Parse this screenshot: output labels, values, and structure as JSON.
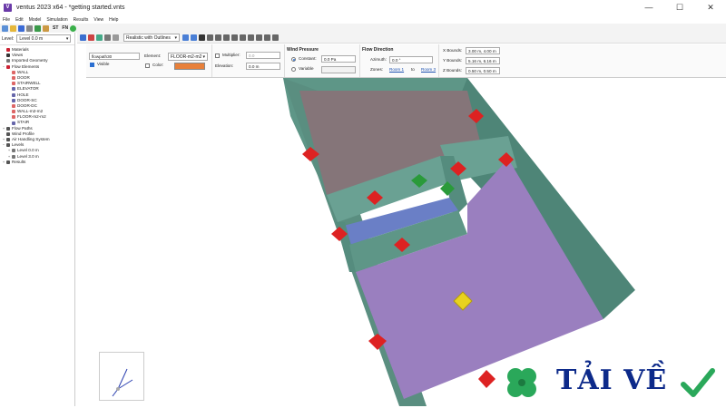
{
  "window": {
    "title": "ventus 2023 x64 - *getting started.vnts",
    "app_icon": "V"
  },
  "menu": [
    "File",
    "Edit",
    "Model",
    "Simulation",
    "Results",
    "View",
    "Help"
  ],
  "toolbar": {
    "st_label": "ST",
    "fn_label": "FN"
  },
  "level": {
    "label": "Level:",
    "value": "Level 0.0 m"
  },
  "tree": [
    {
      "label": "Materials",
      "indent": 0,
      "color": "#c23",
      "exp": ""
    },
    {
      "label": "Views",
      "indent": 0,
      "color": "#333",
      "exp": ""
    },
    {
      "label": "Imported Geometry",
      "indent": 0,
      "color": "#777",
      "exp": ""
    },
    {
      "label": "Flow Elements",
      "indent": 0,
      "color": "#c23",
      "exp": "−"
    },
    {
      "label": "WALL",
      "indent": 2,
      "color": "#d66",
      "exp": ""
    },
    {
      "label": "DOOR",
      "indent": 2,
      "color": "#d66",
      "exp": ""
    },
    {
      "label": "STAIRWELL",
      "indent": 2,
      "color": "#d66",
      "exp": ""
    },
    {
      "label": "ELEVATOR",
      "indent": 2,
      "color": "#66a",
      "exp": ""
    },
    {
      "label": "HOLE",
      "indent": 2,
      "color": "#66a",
      "exp": ""
    },
    {
      "label": "DOOR-SC",
      "indent": 2,
      "color": "#66a",
      "exp": ""
    },
    {
      "label": "DOOR-DC",
      "indent": 2,
      "color": "#d66",
      "exp": ""
    },
    {
      "label": "WALL-m2-m2",
      "indent": 2,
      "color": "#d66",
      "exp": ""
    },
    {
      "label": "FLOOR-m2-m2",
      "indent": 2,
      "color": "#d66",
      "exp": ""
    },
    {
      "label": "STAIR",
      "indent": 2,
      "color": "#66a",
      "exp": ""
    },
    {
      "label": "Flow Paths",
      "indent": 0,
      "color": "#555",
      "exp": "+"
    },
    {
      "label": "Wind Profile",
      "indent": 0,
      "color": "#555",
      "exp": ""
    },
    {
      "label": "Air Handling System",
      "indent": 0,
      "color": "#555",
      "exp": "+"
    },
    {
      "label": "Levels",
      "indent": 0,
      "color": "#555",
      "exp": "−"
    },
    {
      "label": "Level 0.0 m",
      "indent": 2,
      "color": "#777",
      "exp": "+"
    },
    {
      "label": "Level 3.0 m",
      "indent": 2,
      "color": "#777",
      "exp": "+"
    },
    {
      "label": "Results",
      "indent": 0,
      "color": "#555",
      "exp": "+"
    }
  ],
  "render_mode": "Realistic with Outlines",
  "props": {
    "name": "flowpath30",
    "visible_label": "Visible",
    "element_label": "Element:",
    "element_value": "FLOOR-m2-m2",
    "color_label": "Color:",
    "color_value": "#e8803a",
    "multiplier_label": "Multiplier:",
    "multiplier_value": "0.0",
    "elevation_label": "Elevation:",
    "elevation_value": "0.0 m",
    "wind_title": "Wind Pressure",
    "constant_label": "Constant:",
    "constant_value": "0.0 Pa",
    "variable_label": "Variable",
    "flow_dir_title": "Flow Direction",
    "azimuth_label": "Azimuth:",
    "azimuth_value": "0.0 °",
    "zones_label": "Zones:",
    "zone_from": "Room 1",
    "zone_sep": "to",
    "zone_to": "Room 3",
    "xbounds_label": "X Bounds:",
    "xbounds_value": "3.00 m, 4.00 m",
    "ybounds_label": "Y Bounds:",
    "ybounds_value": "5.16 m, 6.16 m",
    "zbounds_label": "Z Bounds:",
    "zbounds_value": "0.50 m, 0.50 m"
  },
  "watermark": {
    "text": "TẢI VỀ"
  },
  "colors": {
    "floor_purple": "#9a7fbf",
    "wall_teal": "#5e9687",
    "marker_red": "#d22",
    "marker_green": "#2a9a3a"
  }
}
